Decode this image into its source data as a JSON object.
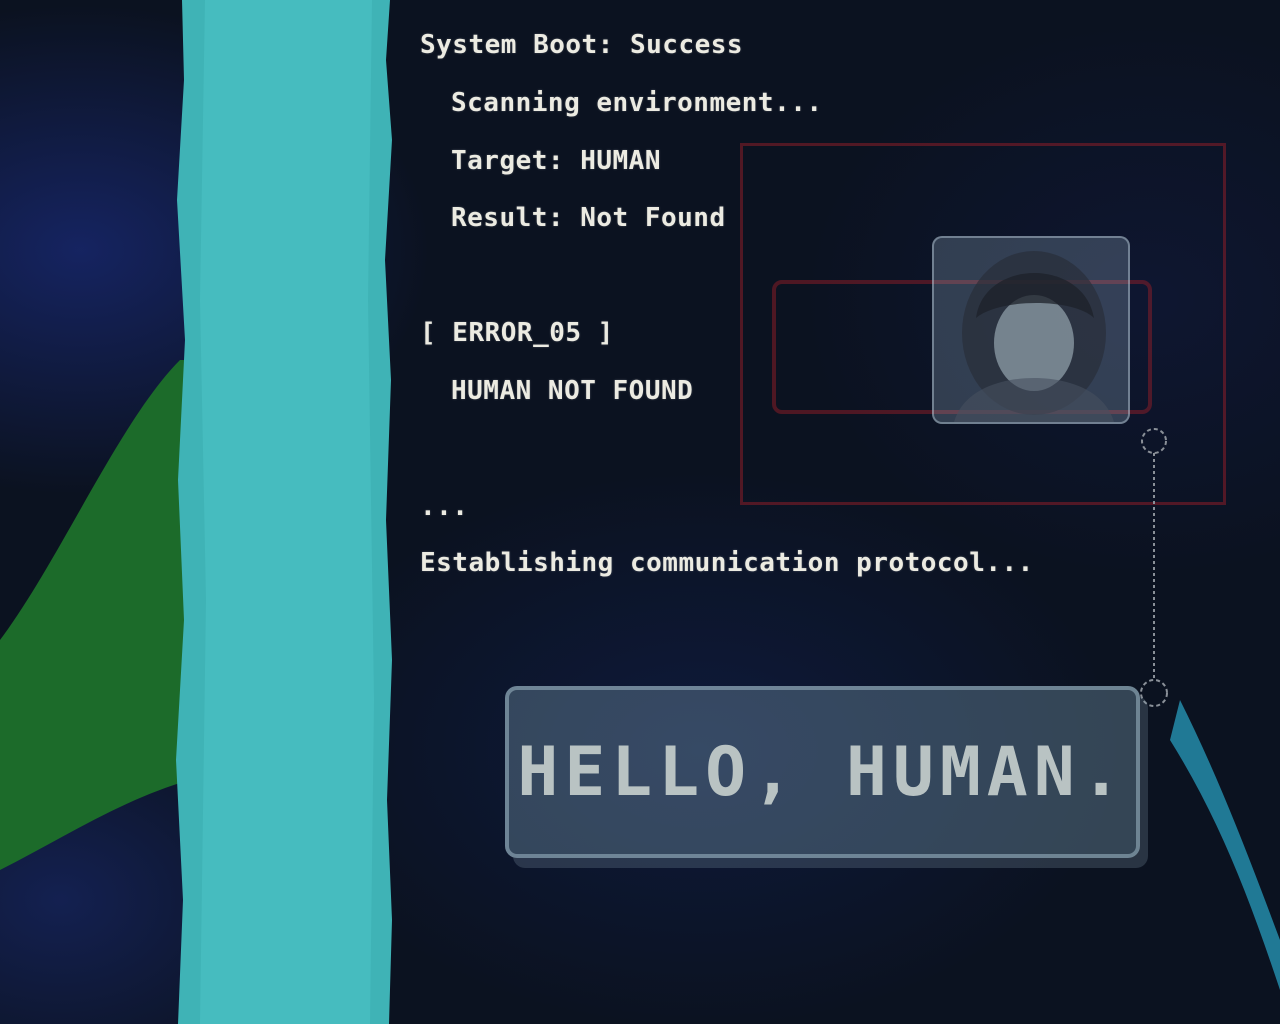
{
  "terminal": {
    "lines": [
      "System Boot: Success",
      "Scanning environment...",
      "Target: HUMAN",
      "Result: Not Found",
      "[ ERROR_05 ]",
      "HUMAN NOT FOUND",
      "...",
      "Establishing communication protocol..."
    ]
  },
  "dialog": {
    "greeting": "HELLO, HUMAN."
  },
  "colors": {
    "background": "#0b1220",
    "teal_stripe": "#3fb3b6",
    "green_shape": "#1c6b2a",
    "text": "#ecebe2",
    "alert_red": "#8c1e28"
  },
  "icons": {
    "portrait": "portrait-image",
    "connector_node": "dashed-circle-icon"
  }
}
